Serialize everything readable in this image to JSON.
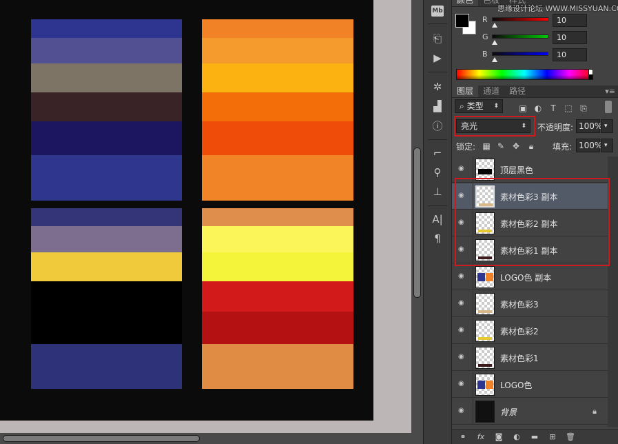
{
  "color_panel": {
    "tabs": [
      "颜色",
      "色板",
      "样式"
    ],
    "watermark": "思缘设计论坛  WWW.MISSYUAN.COM",
    "sliders": [
      {
        "label": "R",
        "value": "10",
        "gradient_start": "#0a0a0a",
        "gradient_end": "#ff0000"
      },
      {
        "label": "G",
        "value": "10",
        "gradient_start": "#0a0a0a",
        "gradient_end": "#00c800"
      },
      {
        "label": "B",
        "value": "10",
        "gradient_start": "#0a0a0a",
        "gradient_end": "#0000ff"
      }
    ],
    "foreground": "#000000",
    "background": "#ffffff"
  },
  "layers_panel": {
    "tabs": [
      "图层",
      "通道",
      "路径"
    ],
    "filter_kind": "类型",
    "blend_mode": "亮光",
    "opacity_label": "不透明度:",
    "opacity_value": "100%",
    "lock_label": "锁定:",
    "fill_label": "填充:",
    "fill_value": "100%",
    "layers": [
      {
        "name": "顶层黑色",
        "selected": false,
        "thumb": "black-top",
        "italic": false
      },
      {
        "name": "素材色彩3 副本",
        "selected": true,
        "thumb": "tan-bar",
        "italic": false
      },
      {
        "name": "素材色彩2 副本",
        "selected": false,
        "thumb": "yellow-bar",
        "italic": false
      },
      {
        "name": "素材色彩1 副本",
        "selected": false,
        "thumb": "dark-bar",
        "italic": false
      },
      {
        "name": "LOGO色 副本",
        "selected": false,
        "thumb": "logo",
        "italic": false
      },
      {
        "name": "素材色彩3",
        "selected": false,
        "thumb": "tan-bar",
        "italic": false
      },
      {
        "name": "素材色彩2",
        "selected": false,
        "thumb": "yellow-bar",
        "italic": false
      },
      {
        "name": "素材色彩1",
        "selected": false,
        "thumb": "dark-bar",
        "italic": false
      },
      {
        "name": "LOGO色",
        "selected": false,
        "thumb": "logo",
        "italic": false
      },
      {
        "name": "背景",
        "selected": false,
        "thumb": "black",
        "italic": true,
        "locked": true
      }
    ]
  },
  "toolbar": {
    "mb_label": "Mb"
  },
  "canvas": {
    "blocks": [
      {
        "name": "top-left-stripes",
        "colors": [
          "#2d3590",
          "#525092",
          "#7d7466",
          "#3a2326",
          "#1c1660",
          "#2f368e"
        ],
        "weights": [
          27,
          37,
          42,
          42,
          49,
          66
        ]
      },
      {
        "name": "top-right-stripes",
        "colors": [
          "#f28226",
          "#f59a2c",
          "#fcb312",
          "#f36e08",
          "#ee4c08",
          "#f08426"
        ],
        "weights": [
          27,
          37,
          42,
          42,
          49,
          66
        ]
      },
      {
        "name": "bottom-left-stripes",
        "colors": [
          "#343578",
          "#7d6d8f",
          "#f0ca3a",
          "#000000",
          "#000000",
          "#2d3279"
        ],
        "weights": [
          26,
          38,
          42,
          44,
          47,
          65
        ]
      },
      {
        "name": "bottom-right-stripes",
        "colors": [
          "#e08e4c",
          "#fbf55a",
          "#f4f53a",
          "#d31a1a",
          "#b41212",
          "#e08c44"
        ],
        "weights": [
          26,
          38,
          42,
          44,
          47,
          65
        ]
      }
    ]
  }
}
